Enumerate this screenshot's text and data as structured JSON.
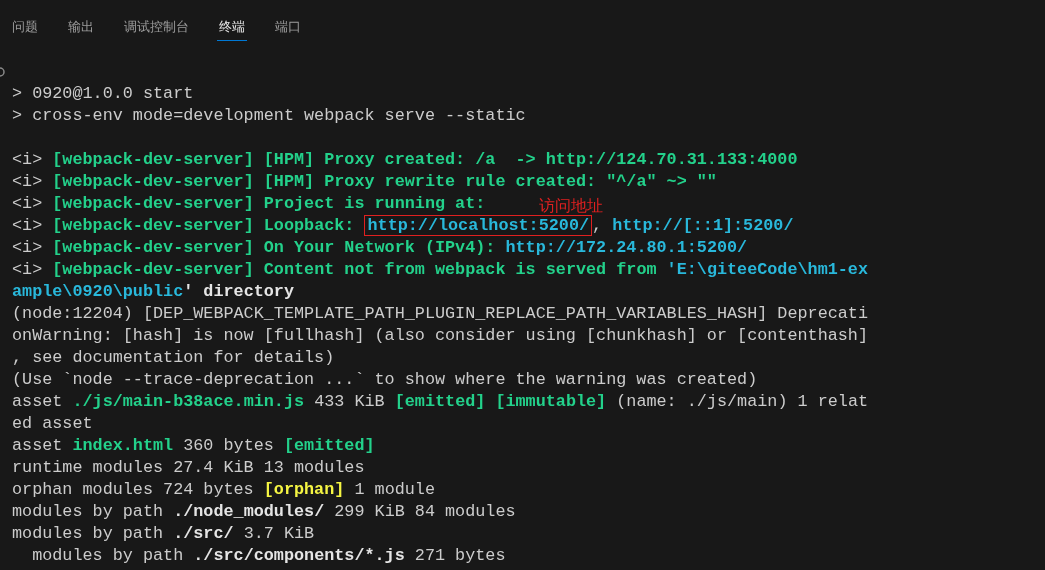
{
  "tabs": [
    {
      "label": "问题",
      "selected": false
    },
    {
      "label": "输出",
      "selected": false
    },
    {
      "label": "调试控制台",
      "selected": false
    },
    {
      "label": "终端",
      "selected": true
    },
    {
      "label": "端口",
      "selected": false
    }
  ],
  "annotation": {
    "text": "访问地址"
  },
  "blocks": [
    {
      "lines": [
        {
          "segments": [
            {
              "text": "> 0920@1.0.0 start",
              "kind": "output"
            }
          ]
        },
        {
          "segments": [
            {
              "text": "> cross-env mode=development webpack serve --static",
              "kind": "output"
            }
          ]
        }
      ]
    },
    {
      "lines": [
        {
          "segments": [
            {
              "text": "<i> ",
              "kind": "output"
            },
            {
              "text": "[webpack-dev-server] [HPM] Proxy created: /a  -> http://124.70.31.133:4000",
              "kind": "message"
            }
          ]
        },
        {
          "segments": [
            {
              "text": "<i> ",
              "kind": "output"
            },
            {
              "text": "[webpack-dev-server] [HPM] Proxy rewrite rule created: \"^/a\" ~> \"\"",
              "kind": "message"
            }
          ]
        },
        {
          "segments": [
            {
              "text": "<i> ",
              "kind": "output"
            },
            {
              "text": "[webpack-dev-server] Project is running at:",
              "kind": "message"
            }
          ]
        },
        {
          "segments": [
            {
              "text": "<i> ",
              "kind": "output"
            },
            {
              "text": "[webpack-dev-server] Loopback: ",
              "kind": "message"
            },
            {
              "text": "http://localhost:5200/",
              "kind": "link",
              "boxed": true
            },
            {
              "text": ", ",
              "kind": "output"
            },
            {
              "text": "http://[::1]:5200/",
              "kind": "link"
            }
          ]
        },
        {
          "segments": [
            {
              "text": "<i> ",
              "kind": "output"
            },
            {
              "text": "[webpack-dev-server] On Your Network (IPv4): ",
              "kind": "message"
            },
            {
              "text": "http://172.24.80.1:5200/",
              "kind": "link"
            }
          ]
        },
        {
          "segments": [
            {
              "text": "<i> ",
              "kind": "output"
            },
            {
              "text": "[webpack-dev-server] Content not from webpack is served from ",
              "kind": "message"
            },
            {
              "text": "'E:\\giteeCode\\hm1-ex",
              "kind": "link"
            }
          ]
        },
        {
          "segments": [
            {
              "text": "ample\\0920\\public",
              "kind": "link"
            },
            {
              "text": "' directory",
              "kind": "path"
            }
          ]
        },
        {
          "segments": [
            {
              "text": "(node:12204) [DEP_WEBPACK_TEMPLATE_PATH_PLUGIN_REPLACE_PATH_VARIABLES_HASH] Deprecati",
              "kind": "output"
            }
          ]
        },
        {
          "segments": [
            {
              "text": "onWarning: [hash] is now [fullhash] (also consider using [chunkhash] or [contenthash]",
              "kind": "output"
            }
          ]
        },
        {
          "segments": [
            {
              "text": ", see documentation for details)",
              "kind": "output"
            }
          ]
        },
        {
          "segments": [
            {
              "text": "(Use `node --trace-deprecation ...` to show where the warning was created)",
              "kind": "output"
            }
          ]
        },
        {
          "segments": [
            {
              "text": "asset ",
              "kind": "output"
            },
            {
              "text": "./js/main-b38ace.min.js",
              "kind": "message"
            },
            {
              "text": " 433 KiB ",
              "kind": "output"
            },
            {
              "text": "[emitted] [immutable]",
              "kind": "message"
            },
            {
              "text": " (name: ./js/main) 1 relat",
              "kind": "output"
            }
          ]
        },
        {
          "segments": [
            {
              "text": "ed asset",
              "kind": "output"
            }
          ]
        },
        {
          "segments": [
            {
              "text": "asset ",
              "kind": "output"
            },
            {
              "text": "index.html",
              "kind": "message"
            },
            {
              "text": " 360 bytes ",
              "kind": "output"
            },
            {
              "text": "[emitted]",
              "kind": "message"
            }
          ]
        },
        {
          "segments": [
            {
              "text": "runtime modules 27.4 KiB 13 modules",
              "kind": "output"
            }
          ]
        },
        {
          "segments": [
            {
              "text": "orphan modules 724 bytes ",
              "kind": "output"
            },
            {
              "text": "[orphan]",
              "kind": "warning"
            },
            {
              "text": " 1 module",
              "kind": "output"
            }
          ]
        },
        {
          "segments": [
            {
              "text": "modules by path ",
              "kind": "output"
            },
            {
              "text": "./node_modules/",
              "kind": "path"
            },
            {
              "text": " 299 KiB 84 modules",
              "kind": "output"
            }
          ]
        },
        {
          "segments": [
            {
              "text": "modules by path ",
              "kind": "output"
            },
            {
              "text": "./src/",
              "kind": "path"
            },
            {
              "text": " 3.7 KiB",
              "kind": "output"
            }
          ]
        },
        {
          "segments": [
            {
              "text": "  modules by path ",
              "kind": "output"
            },
            {
              "text": "./src/components/*.js",
              "kind": "path"
            },
            {
              "text": " 271 bytes",
              "kind": "output"
            }
          ]
        }
      ]
    }
  ]
}
